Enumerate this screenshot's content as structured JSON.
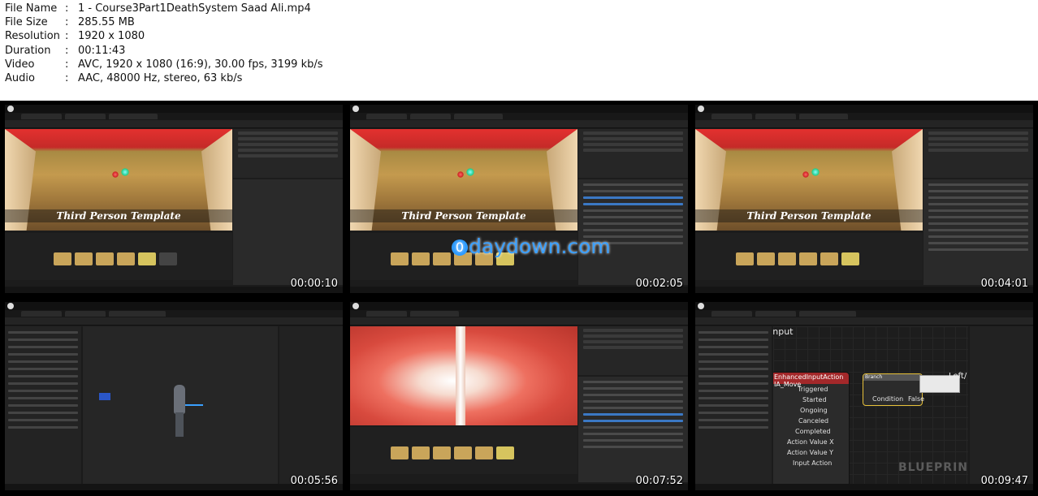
{
  "file_info": [
    {
      "key": "File Name",
      "value": "1 - Course3Part1DeathSystem Saad Ali.mp4"
    },
    {
      "key": "File Size",
      "value": "285.55 MB"
    },
    {
      "key": "Resolution",
      "value": "1920 x 1080"
    },
    {
      "key": "Duration",
      "value": "00:11:43"
    },
    {
      "key": "Video",
      "value": "AVC, 1920 x 1080 (16:9), 30.00 fps, 3199 kb/s"
    },
    {
      "key": "Audio",
      "value": "AAC, 48000 Hz, stereo, 63 kb/s"
    }
  ],
  "separator": ":",
  "thumbnails": [
    {
      "timestamp": "00:00:10",
      "kind": "level"
    },
    {
      "timestamp": "00:02:05",
      "kind": "level-chat"
    },
    {
      "timestamp": "00:04:01",
      "kind": "level-chat"
    },
    {
      "timestamp": "00:05:56",
      "kind": "blueprint-viewport"
    },
    {
      "timestamp": "00:07:52",
      "kind": "level-red"
    },
    {
      "timestamp": "00:09:47",
      "kind": "blueprint-graph"
    }
  ],
  "viewport_banner": "Third Person Template",
  "watermark": "0daydown.com",
  "graph": {
    "panel_label": "Input",
    "node_title": "EnhancedInputAction IA_Move",
    "pins": [
      "Triggered",
      "Started",
      "Ongoing",
      "Canceled",
      "Completed",
      "Action Value X",
      "Action Value Y",
      "Input Action"
    ],
    "branch_label": "Branch",
    "branch_pins": [
      "Condition",
      "False"
    ],
    "side_label": "Left/",
    "blueprint_watermark": "BLUEPRINT"
  }
}
